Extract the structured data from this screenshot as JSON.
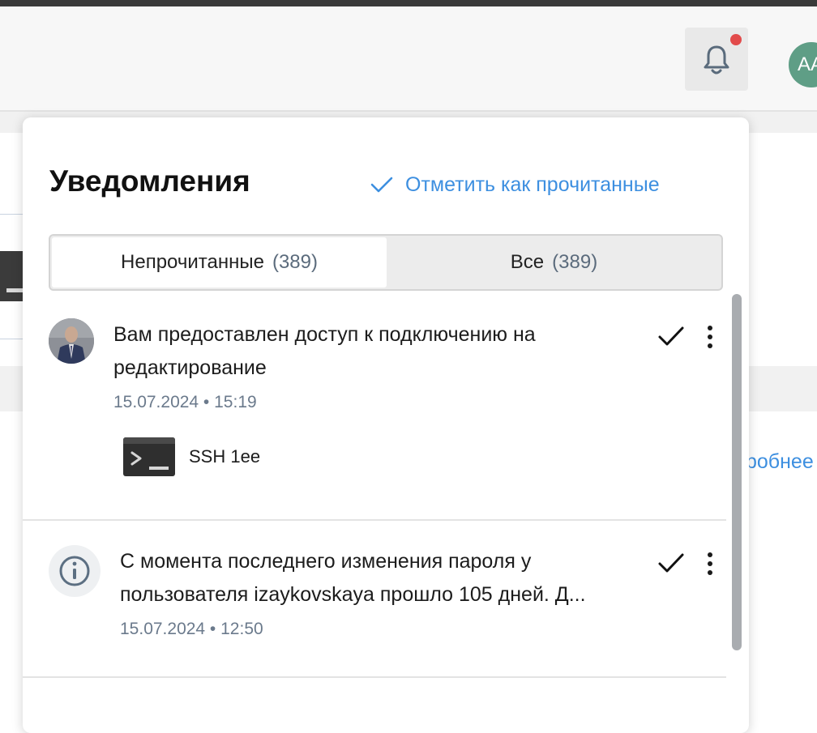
{
  "header": {
    "notifications_button": {
      "icon": "bell-icon",
      "has_unread_dot": true,
      "dot_color": "#e24b4b"
    },
    "user_avatar": {
      "initials": "AA",
      "color": "#5f9e86"
    }
  },
  "background": {
    "link_fragment": "робнее"
  },
  "panel": {
    "title": "Уведомления",
    "mark_all_read": "Отметить как прочитанные",
    "accent_color": "#3d8fe0",
    "tabs": [
      {
        "label": "Непрочитанные",
        "count": "(389)",
        "active": true
      },
      {
        "label": "Все",
        "count": "(389)",
        "active": false
      }
    ],
    "notifications": [
      {
        "avatar": "user-photo",
        "text": "Вам предоставлен доступ к подключению на редактирование",
        "time": "15.07.2024 • 15:19",
        "resource": {
          "icon": "terminal-icon",
          "name": "SSH 1ee"
        }
      },
      {
        "avatar": "info-icon",
        "text": "С момента последнего изменения пароля у пользователя izaykovskaya прошло 105 дней. Д...",
        "time": "15.07.2024 • 12:50"
      }
    ]
  }
}
